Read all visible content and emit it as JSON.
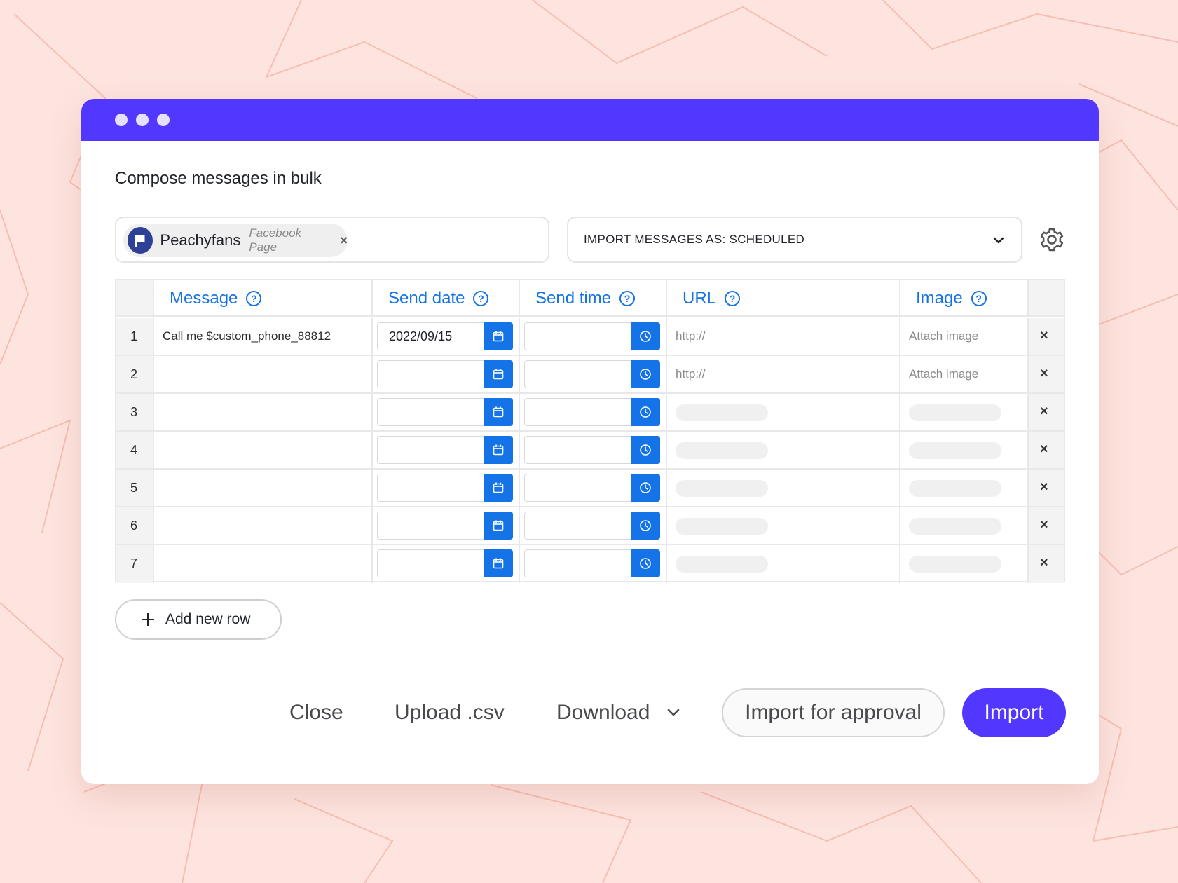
{
  "colors": {
    "titlebar": "#5237ff",
    "accent_blue": "#1473e6",
    "primary_button": "#5237ff",
    "background": "#fde4df"
  },
  "page": {
    "title": "Compose messages in bulk"
  },
  "account_chip": {
    "name": "Peachyfans",
    "type": "Facebook Page",
    "icon": "flag-icon",
    "remove_label": "×"
  },
  "import_select": {
    "value": "IMPORT MESSAGES AS: SCHEDULED"
  },
  "table": {
    "headers": {
      "message": "Message",
      "send_date": "Send date",
      "send_time": "Send time",
      "url": "URL",
      "image": "Image",
      "help": "?"
    },
    "rows": [
      {
        "num": "1",
        "message": "Call me $custom_phone_88812",
        "date": "2022/09/15",
        "time": "",
        "url": "http://",
        "image": "Attach image",
        "delete": "×"
      },
      {
        "num": "2",
        "message": "",
        "date": "",
        "time": "",
        "url": "http://",
        "image": "Attach image",
        "delete": "×"
      },
      {
        "num": "3",
        "message": "",
        "date": "",
        "time": "",
        "url": "",
        "image": "",
        "delete": "×"
      },
      {
        "num": "4",
        "message": "",
        "date": "",
        "time": "",
        "url": "",
        "image": "",
        "delete": "×"
      },
      {
        "num": "5",
        "message": "",
        "date": "",
        "time": "",
        "url": "",
        "image": "",
        "delete": "×"
      },
      {
        "num": "6",
        "message": "",
        "date": "",
        "time": "",
        "url": "",
        "image": "",
        "delete": "×"
      },
      {
        "num": "7",
        "message": "",
        "date": "",
        "time": "",
        "url": "",
        "image": "",
        "delete": "×"
      }
    ]
  },
  "add_row": {
    "label": "Add new row"
  },
  "footer": {
    "close": "Close",
    "upload": "Upload .csv",
    "download": "Download",
    "import_for_approval": "Import for approval",
    "import": "Import"
  }
}
